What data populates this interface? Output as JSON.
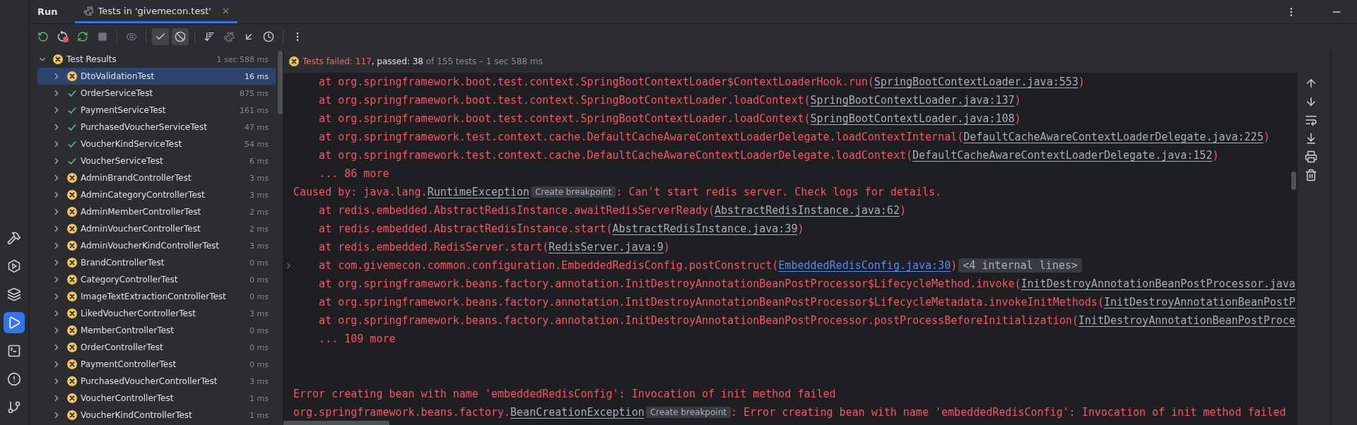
{
  "tool_window": {
    "title": "Run"
  },
  "tabs": [
    {
      "label": "Tests in 'givemecon.test'",
      "selected": true
    }
  ],
  "sidebar": {
    "items": [
      {
        "kind": "build",
        "selected": false
      },
      {
        "kind": "services",
        "selected": false
      },
      {
        "kind": "layers",
        "selected": false
      },
      {
        "kind": "run",
        "selected": true
      },
      {
        "kind": "terminal",
        "selected": false
      },
      {
        "kind": "problems",
        "selected": false
      },
      {
        "kind": "git",
        "selected": false
      }
    ]
  },
  "filters": [
    {
      "kind": "passed",
      "on": true
    },
    {
      "kind": "ignored",
      "on": true
    }
  ],
  "tree": {
    "name": "Test Results",
    "time": "1 sec 588 ms",
    "kind": "failed",
    "expanded": true,
    "children": [
      {
        "name": "DtoValidationTest",
        "time": "16 ms",
        "kind": "failed",
        "selected": true,
        "expanded": false
      },
      {
        "name": "OrderServiceTest",
        "time": "875 ms",
        "kind": "passed",
        "selected": false,
        "expanded": false
      },
      {
        "name": "PaymentServiceTest",
        "time": "161 ms",
        "kind": "passed",
        "selected": false,
        "expanded": false
      },
      {
        "name": "PurchasedVoucherServiceTest",
        "time": "47 ms",
        "kind": "passed",
        "selected": false,
        "expanded": false
      },
      {
        "name": "VoucherKindServiceTest",
        "time": "54 ms",
        "kind": "passed",
        "selected": false,
        "expanded": false
      },
      {
        "name": "VoucherServiceTest",
        "time": "6 ms",
        "kind": "passed",
        "selected": false,
        "expanded": false
      },
      {
        "name": "AdminBrandControllerTest",
        "time": "3 ms",
        "kind": "failed",
        "selected": false,
        "expanded": false
      },
      {
        "name": "AdminCategoryControllerTest",
        "time": "3 ms",
        "kind": "failed",
        "selected": false,
        "expanded": false
      },
      {
        "name": "AdminMemberControllerTest",
        "time": "2 ms",
        "kind": "failed",
        "selected": false,
        "expanded": false
      },
      {
        "name": "AdminVoucherControllerTest",
        "time": "2 ms",
        "kind": "failed",
        "selected": false,
        "expanded": false
      },
      {
        "name": "AdminVoucherKindControllerTest",
        "time": "3 ms",
        "kind": "failed",
        "selected": false,
        "expanded": false
      },
      {
        "name": "BrandControllerTest",
        "time": "0 ms",
        "kind": "failed",
        "selected": false,
        "expanded": false
      },
      {
        "name": "CategoryControllerTest",
        "time": "0 ms",
        "kind": "failed",
        "selected": false,
        "expanded": false
      },
      {
        "name": "ImageTextExtractionControllerTest",
        "time": "0 ms",
        "kind": "failed",
        "selected": false,
        "expanded": false
      },
      {
        "name": "LikedVoucherControllerTest",
        "time": "3 ms",
        "kind": "failed",
        "selected": false,
        "expanded": false
      },
      {
        "name": "MemberControllerTest",
        "time": "0 ms",
        "kind": "failed",
        "selected": false,
        "expanded": false
      },
      {
        "name": "OrderControllerTest",
        "time": "0 ms",
        "kind": "failed",
        "selected": false,
        "expanded": false
      },
      {
        "name": "PaymentControllerTest",
        "time": "0 ms",
        "kind": "failed",
        "selected": false,
        "expanded": false
      },
      {
        "name": "PurchasedVoucherControllerTest",
        "time": "3 ms",
        "kind": "failed",
        "selected": false,
        "expanded": false
      },
      {
        "name": "VoucherControllerTest",
        "time": "1 ms",
        "kind": "failed",
        "selected": false,
        "expanded": false
      },
      {
        "name": "VoucherKindControllerTest",
        "time": "1 ms",
        "kind": "failed",
        "selected": false,
        "expanded": false
      }
    ]
  },
  "summary": {
    "kind": "failed",
    "segments": [
      {
        "kind": "failed",
        "text": "Tests failed: 117"
      },
      {
        "kind": "passed",
        "text": ", passed: 38"
      },
      {
        "kind": "info",
        "text": " of 155 tests – 1 sec 588 ms"
      }
    ]
  },
  "console": {
    "lines": [
      {
        "kind": "trace",
        "segments": [
          {
            "kind": "text",
            "text": "    at org.springframework.boot.test.context.SpringBootContextLoader$ContextLoaderHook.run("
          },
          {
            "kind": "link",
            "text": "SpringBootContextLoader.java:553"
          },
          {
            "kind": "text",
            "text": ")"
          }
        ]
      },
      {
        "kind": "trace",
        "segments": [
          {
            "kind": "text",
            "text": "    at org.springframework.boot.test.context.SpringBootContextLoader.loadContext("
          },
          {
            "kind": "link",
            "text": "SpringBootContextLoader.java:137"
          },
          {
            "kind": "text",
            "text": ")"
          }
        ]
      },
      {
        "kind": "trace",
        "segments": [
          {
            "kind": "text",
            "text": "    at org.springframework.boot.test.context.SpringBootContextLoader.loadContext("
          },
          {
            "kind": "link",
            "text": "SpringBootContextLoader.java:108"
          },
          {
            "kind": "text",
            "text": ")"
          }
        ]
      },
      {
        "kind": "trace",
        "segments": [
          {
            "kind": "text",
            "text": "    at org.springframework.test.context.cache.DefaultCacheAwareContextLoaderDelegate.loadContextInternal("
          },
          {
            "kind": "link",
            "text": "DefaultCacheAwareContextLoaderDelegate.java:225"
          },
          {
            "kind": "text",
            "text": ")"
          }
        ]
      },
      {
        "kind": "trace",
        "segments": [
          {
            "kind": "text",
            "text": "    at org.springframework.test.context.cache.DefaultCacheAwareContextLoaderDelegate.loadContext("
          },
          {
            "kind": "link",
            "text": "DefaultCacheAwareContextLoaderDelegate.java:152"
          },
          {
            "kind": "text",
            "text": ")"
          }
        ]
      },
      {
        "kind": "trace",
        "segments": [
          {
            "kind": "text",
            "text": "    ... 86 more"
          }
        ]
      },
      {
        "kind": "trace",
        "segments": [
          {
            "kind": "text",
            "text": "Caused by: java.lang."
          },
          {
            "kind": "link",
            "text": "RuntimeException"
          },
          {
            "kind": "hint",
            "text": "Create breakpoint"
          },
          {
            "kind": "text",
            "text": ": Can't start redis server. Check logs for details."
          }
        ]
      },
      {
        "kind": "trace",
        "segments": [
          {
            "kind": "text",
            "text": "    at redis.embedded.AbstractRedisInstance.awaitRedisServerReady("
          },
          {
            "kind": "link",
            "text": "AbstractRedisInstance.java:62"
          },
          {
            "kind": "text",
            "text": ")"
          }
        ]
      },
      {
        "kind": "trace",
        "segments": [
          {
            "kind": "text",
            "text": "    at redis.embedded.AbstractRedisInstance.start("
          },
          {
            "kind": "link",
            "text": "AbstractRedisInstance.java:39"
          },
          {
            "kind": "text",
            "text": ")"
          }
        ]
      },
      {
        "kind": "trace",
        "segments": [
          {
            "kind": "text",
            "text": "    at redis.embedded.RedisServer.start("
          },
          {
            "kind": "link",
            "text": "RedisServer.java:9"
          },
          {
            "kind": "text",
            "text": ")"
          }
        ]
      },
      {
        "kind": "trace",
        "foldable": true,
        "segments": [
          {
            "kind": "text",
            "text": "    at com.givemecon.common.configuration.EmbeddedRedisConfig.postConstruct("
          },
          {
            "kind": "source_link",
            "text": "EmbeddedRedisConfig.java:30"
          },
          {
            "kind": "text",
            "text": ")"
          },
          {
            "kind": "fold",
            "text": "<4 internal lines>"
          }
        ]
      },
      {
        "kind": "trace",
        "segments": [
          {
            "kind": "text",
            "text": "    at org.springframework.beans.factory.annotation.InitDestroyAnnotationBeanPostProcessor$LifecycleMethod.invoke("
          },
          {
            "kind": "link",
            "text": "InitDestroyAnnotationBeanPostProcessor.java"
          }
        ]
      },
      {
        "kind": "trace",
        "segments": [
          {
            "kind": "text",
            "text": "    at org.springframework.beans.factory.annotation.InitDestroyAnnotationBeanPostProcessor$LifecycleMetadata.invokeInitMethods("
          },
          {
            "kind": "link",
            "text": "InitDestroyAnnotationBeanPostP"
          }
        ]
      },
      {
        "kind": "trace",
        "segments": [
          {
            "kind": "text",
            "text": "    at org.springframework.beans.factory.annotation.InitDestroyAnnotationBeanPostProcessor.postProcessBeforeInitialization("
          },
          {
            "kind": "link",
            "text": "InitDestroyAnnotationBeanPostProce"
          }
        ]
      },
      {
        "kind": "trace",
        "segments": [
          {
            "kind": "text",
            "text": "    ... 109 more"
          }
        ]
      },
      {
        "kind": "blank"
      },
      {
        "kind": "blank"
      },
      {
        "kind": "trace",
        "segments": [
          {
            "kind": "text",
            "text": "Error creating bean with name 'embeddedRedisConfig': Invocation of init method failed"
          }
        ]
      },
      {
        "kind": "trace",
        "segments": [
          {
            "kind": "text",
            "text": "org.springframework.beans.factory."
          },
          {
            "kind": "link",
            "text": "BeanCreationException"
          },
          {
            "kind": "hint",
            "text": "Create breakpoint"
          },
          {
            "kind": "text",
            "text": ": Error creating bean with name 'embeddedRedisConfig': Invocation of init method failed"
          }
        ]
      }
    ]
  }
}
